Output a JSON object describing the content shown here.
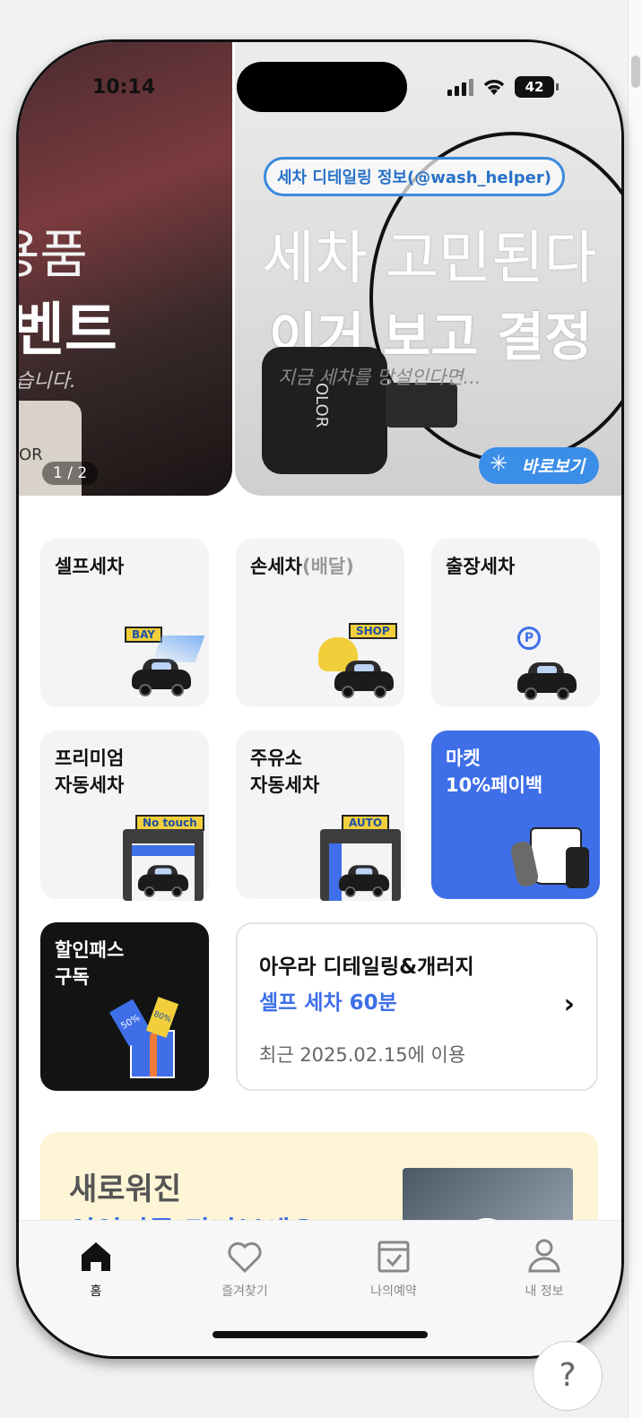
{
  "status_bar": {
    "time": "10:14",
    "battery": "42"
  },
  "banner": {
    "counter": "1 / 2",
    "slide1": {
      "line1": "용품",
      "line2": "벤트",
      "sub": "습니다.",
      "bottle_label": "OR"
    },
    "slide2": {
      "tag": "세차 디테일링 정보(@wash_helper)",
      "title1": "세차 고민된다",
      "title2": "이거 보고 결정",
      "sub": "지금 세차를 망설인다면...",
      "bottle_label": "OLOR",
      "cta": "바로보기"
    }
  },
  "tiles": [
    {
      "label1": "셀프세차",
      "sign": "BAY"
    },
    {
      "label1": "손세차",
      "label_gray": "(배달)",
      "sign": "SHOP"
    },
    {
      "label1": "출장세차",
      "sign": "P"
    },
    {
      "label1": "프리미엄",
      "label2": "자동세차",
      "sign": "No touch"
    },
    {
      "label1": "주유소",
      "label2": "자동세차",
      "sign": "AUTO"
    },
    {
      "label1": "마켓",
      "label2": "10%페이백"
    },
    {
      "label1": "할인패스",
      "label2": "구독",
      "badge1": "50%",
      "badge2": "80%"
    }
  ],
  "recent": {
    "name": "아우라 디테일링&개러지",
    "service": "셀프 세차 60분",
    "last_used": "최근 2025.02.15에 이용"
  },
  "promo": {
    "title": "새로워진",
    "subtitle": "인인피를 만나보세요!"
  },
  "tabbar": [
    {
      "label": "홈",
      "icon": "home-icon"
    },
    {
      "label": "즐겨찾기",
      "icon": "heart-icon"
    },
    {
      "label": "나의예약",
      "icon": "calendar-check-icon"
    },
    {
      "label": "내 정보",
      "icon": "user-icon"
    }
  ],
  "help": "?"
}
